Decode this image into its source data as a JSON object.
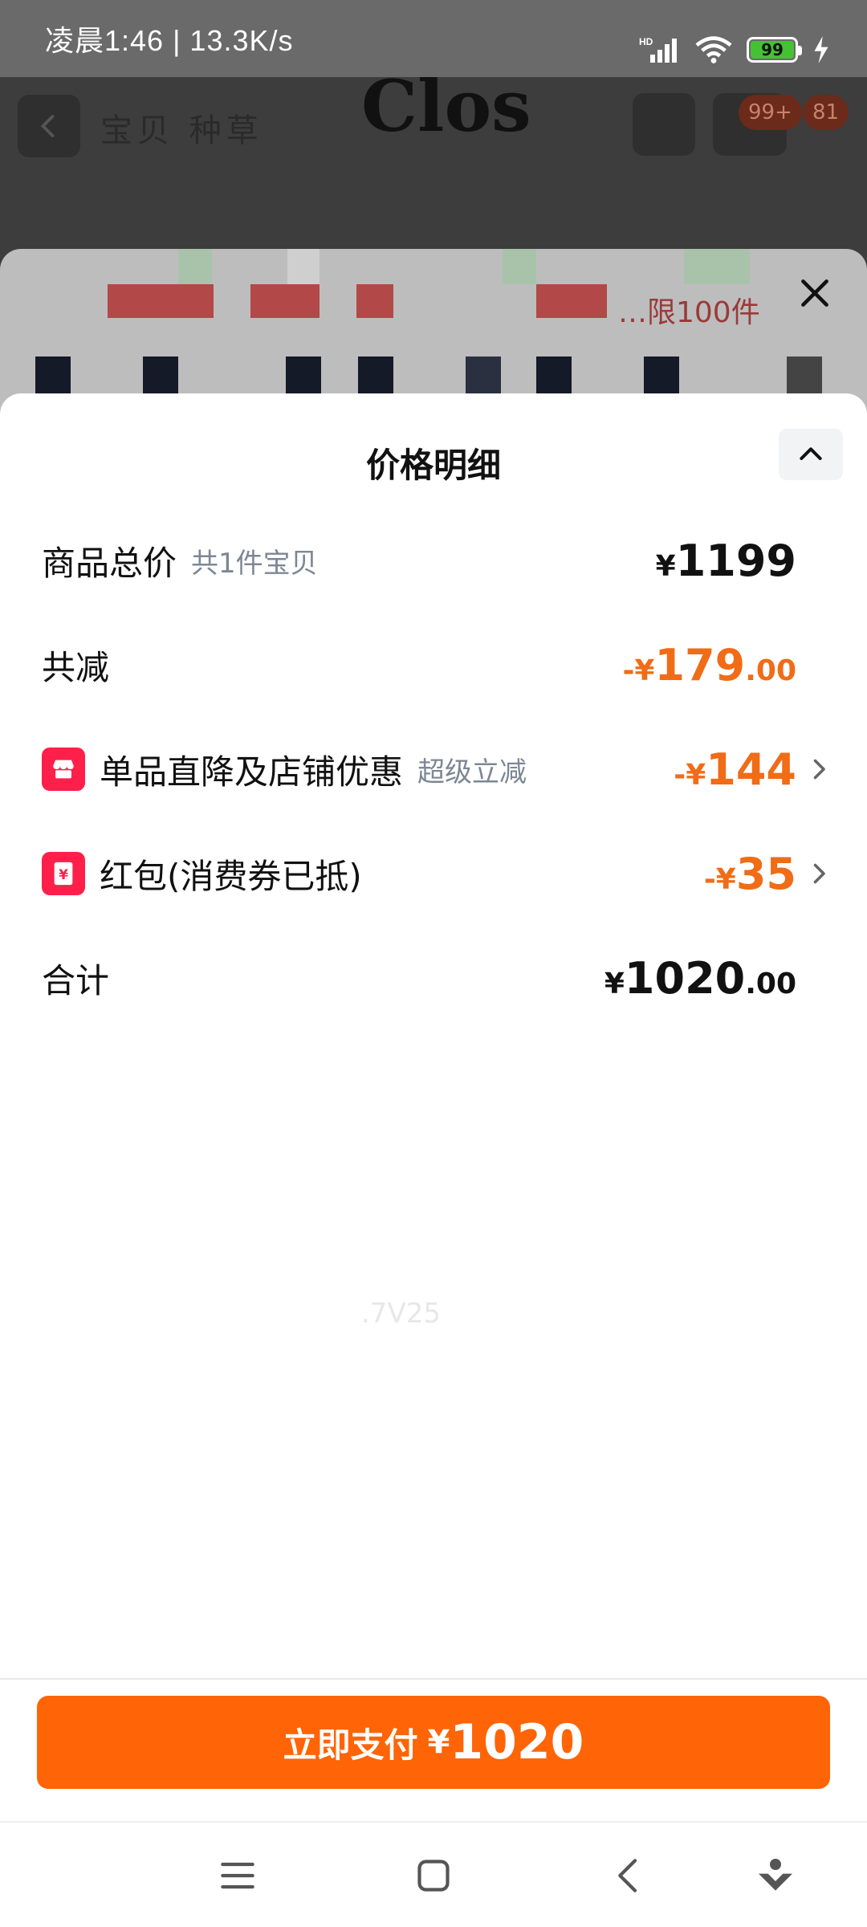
{
  "status_bar": {
    "time_speed": "凌晨1:46 | 13.3K/s",
    "battery": "99",
    "network": "HD"
  },
  "background": {
    "tabs": "宝贝  种草",
    "logo": "Clos",
    "cart_badge": "99+",
    "message_badge": "81",
    "limit_text": "…限100件"
  },
  "sheet": {
    "title": "价格明细",
    "rows": [
      {
        "label": "商品总价",
        "sub": "共1件宝贝",
        "yen": "¥",
        "int": "1199",
        "dec": ""
      },
      {
        "label": "共减",
        "sub": "",
        "yen": "-¥",
        "int": "179",
        "dec": ".00"
      },
      {
        "label": "单品直降及店铺优惠",
        "sub": "超级立减",
        "yen": "-¥",
        "int": "144",
        "dec": "",
        "icon": "shop-icon"
      },
      {
        "label": "红包(消费券已抵)",
        "sub": "",
        "yen": "-¥",
        "int": "35",
        "dec": "",
        "icon": "red-envelope-icon"
      },
      {
        "label": "合计",
        "sub": "",
        "yen": "¥",
        "int": "1020",
        "dec": ".00"
      }
    ],
    "watermark": ".7V25"
  },
  "pay_button": {
    "label": "立即支付",
    "yen": "¥",
    "amount": "1020"
  },
  "colors": {
    "accent_orange": "#ff6406",
    "discount_orange": "#f06c16",
    "icon_red": "#ff1f4b"
  }
}
